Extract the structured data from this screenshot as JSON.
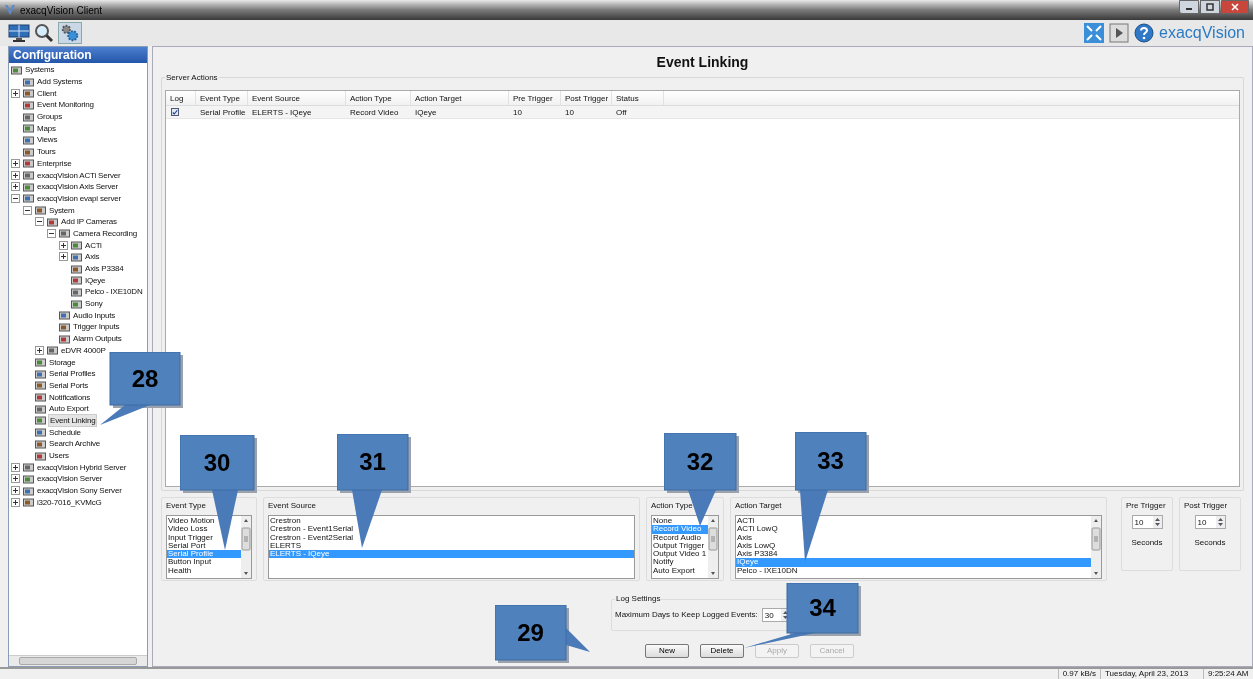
{
  "window": {
    "title": "exacqVision Client"
  },
  "toolbar": {
    "logo": "exacqVision"
  },
  "sidebar": {
    "title": "Configuration",
    "tree": [
      {
        "label": "Systems",
        "selected": false,
        "children": [
          {
            "label": "Add Systems",
            "selected": false
          },
          {
            "label": "Client",
            "selected": false,
            "expanded": false
          },
          {
            "label": "Event Monitoring",
            "selected": false
          },
          {
            "label": "Groups",
            "selected": false
          },
          {
            "label": "Maps",
            "selected": false
          },
          {
            "label": "Views",
            "selected": false
          },
          {
            "label": "Tours",
            "selected": false
          },
          {
            "label": "Enterprise",
            "selected": false,
            "expanded": false
          },
          {
            "label": "exacqVision ACTi Server",
            "selected": false,
            "expanded": false
          },
          {
            "label": "exacqVision Axis Server",
            "selected": false,
            "expanded": false
          },
          {
            "label": "exacqVision evapi server",
            "selected": false,
            "expanded": true,
            "children": [
              {
                "label": "System",
                "selected": false,
                "expanded": true,
                "children": [
                  {
                    "label": "Add IP Cameras",
                    "selected": false,
                    "expanded": true,
                    "children": [
                      {
                        "label": "Camera Recording",
                        "selected": false,
                        "expanded": true,
                        "children": [
                          {
                            "label": "ACTi",
                            "selected": false,
                            "expanded": false
                          },
                          {
                            "label": "Axis",
                            "selected": false,
                            "expanded": false
                          },
                          {
                            "label": "Axis P3384",
                            "selected": false
                          },
                          {
                            "label": "IQeye",
                            "selected": false
                          },
                          {
                            "label": "Pelco - IXE10DN",
                            "selected": false
                          },
                          {
                            "label": "Sony",
                            "selected": false
                          }
                        ]
                      },
                      {
                        "label": "Audio Inputs",
                        "selected": false
                      },
                      {
                        "label": "Trigger Inputs",
                        "selected": false
                      },
                      {
                        "label": "Alarm Outputs",
                        "selected": false
                      }
                    ]
                  },
                  {
                    "label": "eDVR 4000P",
                    "selected": false,
                    "expanded": false
                  }
                ]
              },
              {
                "label": "Storage",
                "selected": false
              },
              {
                "label": "Serial Profiles",
                "selected": false
              },
              {
                "label": "Serial Ports",
                "selected": false
              },
              {
                "label": "Notifications",
                "selected": false
              },
              {
                "label": "Auto Export",
                "selected": false
              },
              {
                "label": "Event Linking",
                "selected": true
              },
              {
                "label": "Schedule",
                "selected": false
              },
              {
                "label": "Search Archive",
                "selected": false
              },
              {
                "label": "Users",
                "selected": false
              }
            ]
          },
          {
            "label": "exacqVision Hybrid Server",
            "selected": false,
            "expanded": false
          },
          {
            "label": "exacqVision Server",
            "selected": false,
            "expanded": false
          },
          {
            "label": "exacqVision Sony Server",
            "selected": false,
            "expanded": false
          },
          {
            "label": "i320-7016_KVMcG",
            "selected": false,
            "expanded": false
          }
        ]
      }
    ]
  },
  "main": {
    "title": "Event Linking",
    "server_actions": {
      "label": "Server Actions",
      "log_column": "Log",
      "columns": [
        "Event Type",
        "Event Source",
        "Action Type",
        "Action Target",
        "Pre Trigger",
        "Post Trigger",
        "Status"
      ],
      "rows": [
        {
          "log": true,
          "cells": [
            "Serial Profile",
            "ELERTS - IQeye",
            "Record Video",
            "IQeye",
            "10",
            "10",
            "Off"
          ]
        }
      ]
    },
    "lists": [
      {
        "label": "Event Type",
        "scrollbar": true,
        "items": [
          {
            "label": "Video Motion",
            "selected": false
          },
          {
            "label": "Video Loss",
            "selected": false
          },
          {
            "label": "Input Trigger",
            "selected": false
          },
          {
            "label": "Serial Port",
            "selected": false
          },
          {
            "label": "Serial Profile",
            "selected": true
          },
          {
            "label": "Button Input",
            "selected": false
          },
          {
            "label": "Health",
            "selected": false
          }
        ]
      },
      {
        "label": "Event Source",
        "scrollbar": false,
        "items": [
          {
            "label": "Crestron",
            "selected": false
          },
          {
            "label": "Crestron - Event1Serial",
            "selected": false
          },
          {
            "label": "Crestron - Event2Serial",
            "selected": false
          },
          {
            "label": "ELERTS",
            "selected": false
          },
          {
            "label": "ELERTS - IQeye",
            "selected": true
          }
        ]
      },
      {
        "label": "Action Type",
        "scrollbar": true,
        "items": [
          {
            "label": "None",
            "selected": false
          },
          {
            "label": "Record Video",
            "selected": true
          },
          {
            "label": "Record Audio",
            "selected": false
          },
          {
            "label": "Output Trigger",
            "selected": false
          },
          {
            "label": "Output Video 1",
            "selected": false
          },
          {
            "label": "Notify",
            "selected": false
          },
          {
            "label": "Auto Export",
            "selected": false
          }
        ]
      },
      {
        "label": "Action Target",
        "scrollbar": true,
        "items": [
          {
            "label": "ACTi",
            "selected": false
          },
          {
            "label": "ACTi LowQ",
            "selected": false
          },
          {
            "label": "Axis",
            "selected": false
          },
          {
            "label": "Axis LowQ",
            "selected": false
          },
          {
            "label": "Axis P3384",
            "selected": false
          },
          {
            "label": "IQeye",
            "selected": true
          },
          {
            "label": "Pelco - IXE10DN",
            "selected": false
          }
        ]
      }
    ],
    "triggers": [
      {
        "label": "Pre Trigger",
        "value": "10",
        "unit": "Seconds"
      },
      {
        "label": "Post Trigger",
        "value": "10",
        "unit": "Seconds"
      }
    ],
    "log_settings": {
      "label": "Log Settings",
      "field_label": "Maximum Days to Keep Logged Events:",
      "value": "30"
    },
    "buttons": [
      {
        "label": "New",
        "disabled": false
      },
      {
        "label": "Delete",
        "disabled": false
      },
      {
        "label": "Apply",
        "disabled": true
      },
      {
        "label": "Cancel",
        "disabled": true
      }
    ]
  },
  "status_bar": [
    "0.97 kB/s",
    "Tuesday, April 23, 2013",
    "9:25:24 AM"
  ],
  "callouts": [
    {
      "label": "28"
    },
    {
      "label": "30"
    },
    {
      "label": "31"
    },
    {
      "label": "32"
    },
    {
      "label": "33"
    },
    {
      "label": "29"
    },
    {
      "label": "34"
    }
  ]
}
